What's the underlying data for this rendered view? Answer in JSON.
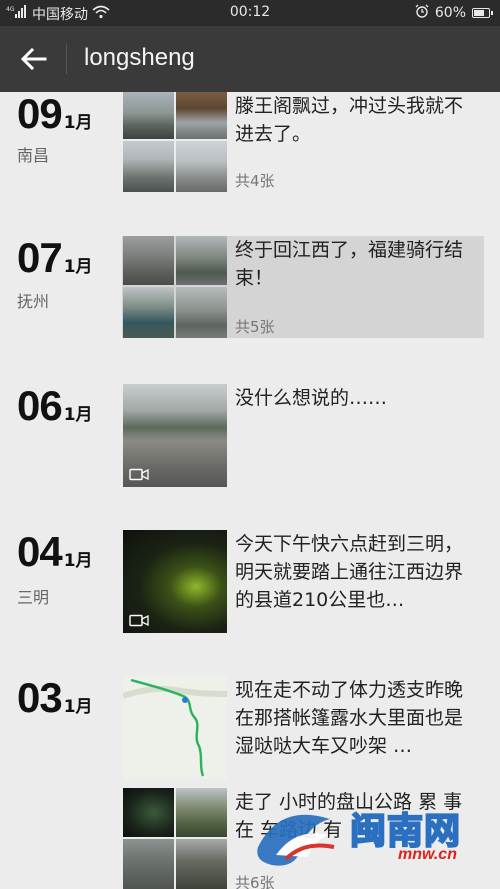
{
  "status": {
    "carrier": "中国移动",
    "time": "00:12",
    "battery": "60%",
    "battery_level": 0.6
  },
  "header": {
    "title": "longsheng",
    "back_icon": "arrow-left-icon"
  },
  "entries": [
    {
      "day": "09",
      "month": "1月",
      "place": "南昌",
      "text": "滕王阁飘过，冲过头我就不进去了。",
      "count": "共4张"
    },
    {
      "day": "07",
      "month": "1月",
      "place": "抚州",
      "text": "终于回江西了，福建骑行结束！",
      "count": "共5张"
    },
    {
      "day": "06",
      "month": "1月",
      "text": "没什么想说的……"
    },
    {
      "day": "04",
      "month": "1月",
      "place": "三明",
      "text": "今天下午快六点赶到三明，明天就要踏上通往江西边界的县道210公里也…"
    },
    {
      "day": "03",
      "month": "1月",
      "text": "现在走不动了体力透支昨晚在那搭帐篷露水大里面也是湿哒哒大车又吵架 …",
      "text2": "走了 小时的盘山公路 累 事 在 车路边 有",
      "count": "共6张"
    }
  ],
  "watermark": {
    "name": "闽南网",
    "url": "mnw.cn"
  }
}
